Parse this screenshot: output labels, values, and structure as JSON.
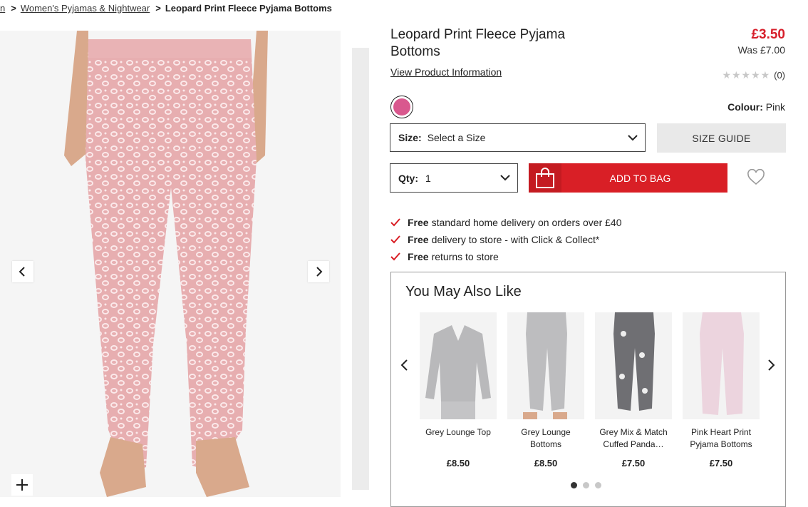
{
  "breadcrumb": {
    "trunc": "n",
    "parent": "Women's Pyjamas & Nightwear",
    "current": "Leopard Print Fleece Pyjama Bottoms"
  },
  "product": {
    "title": "Leopard Print Fleece Pyjama Bottoms",
    "price": "£3.50",
    "was": "Was £7.00",
    "view_info": "View Product Information",
    "stars": "★★★★★",
    "review_count": "(0)",
    "colour_label": "Colour:",
    "colour_value": "Pink",
    "size_label": "Size:",
    "size_value": "Select a Size",
    "size_guide": "SIZE GUIDE",
    "qty_label": "Qty:",
    "qty_value": "1",
    "add_to_bag": "ADD TO BAG"
  },
  "perks": [
    {
      "bold": "Free",
      "text": "standard home delivery on orders over £40"
    },
    {
      "bold": "Free",
      "text": "delivery to store - with Click & Collect*"
    },
    {
      "bold": "Free",
      "text": "returns to store"
    }
  ],
  "recommendations": {
    "heading": "You May Also Like",
    "items": [
      {
        "name": "Grey Lounge Top",
        "price": "£8.50"
      },
      {
        "name": "Grey Lounge Bottoms",
        "price": "£8.50"
      },
      {
        "name": "Grey Mix & Match Cuffed Panda…",
        "price": "£7.50"
      },
      {
        "name": "Pink Heart Print Pyjama Bottoms",
        "price": "£7.50"
      }
    ]
  },
  "colors": {
    "accent": "#d91f26",
    "swatch": "#d9588e",
    "price": "#d71f2b"
  }
}
